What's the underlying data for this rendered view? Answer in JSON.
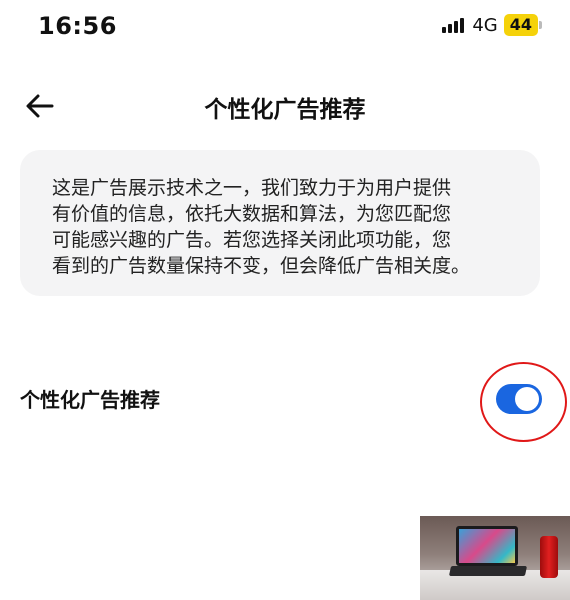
{
  "status_bar": {
    "time": "16:56",
    "network": "4G",
    "battery": "44",
    "battery_color": "#f5d20a"
  },
  "header": {
    "back_icon": "arrow-left-icon",
    "title": "个性化广告推荐"
  },
  "info_card": {
    "lines": [
      "这是广告展示技术之一，我们致力于为用户提供",
      "有价值的信息，依托大数据和算法，为您匹配您",
      "可能感兴趣的广告。若您选择关闭此项功能，您",
      "看到的广告数量保持不变，但会降低广告相关度。"
    ]
  },
  "setting": {
    "label": "个性化广告推荐",
    "enabled": true,
    "toggle_color": "#1a66e0",
    "annotation_color": "#e01818"
  },
  "video_thumbnail": {
    "icon": "video-thumbnail-image"
  }
}
